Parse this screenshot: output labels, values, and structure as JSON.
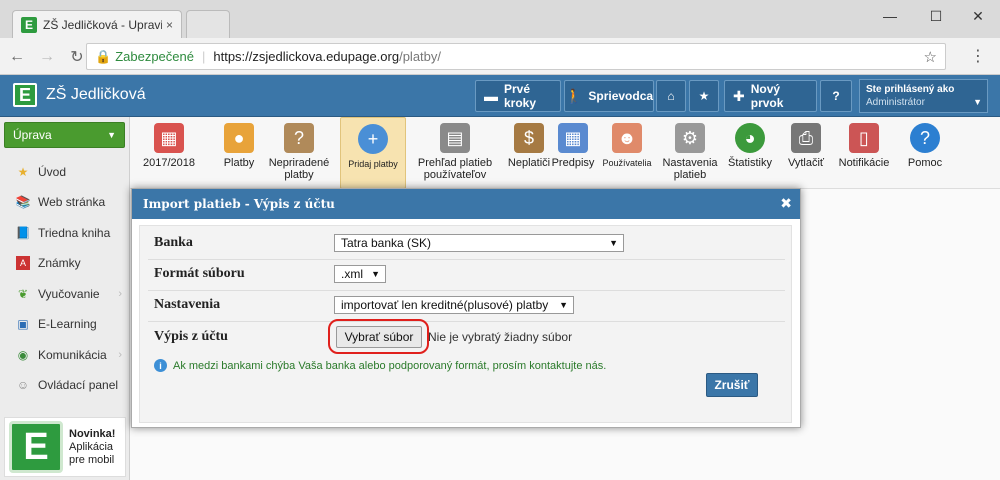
{
  "browser": {
    "tab_title": "ZŠ Jedličková - Upraviť v:",
    "tab_close": "×",
    "omni_secure": "Zabezpečené",
    "omni_host": "https://zsjedlickova.edupage.org",
    "omni_path": "/platby/"
  },
  "header": {
    "school": "ZŠ Jedličková",
    "prve_kroky": "Prvé kroky",
    "sprievodca": "Sprievodca",
    "novy_prvok": "Nový prvok",
    "help": "?",
    "user_label": "Ste prihlásený ako",
    "user_role": "Administrátor"
  },
  "sidebar": {
    "uprava": "Úprava",
    "items": [
      {
        "label": "Úvod",
        "icon": "star-icon",
        "chev": false
      },
      {
        "label": "Web stránka",
        "icon": "books-icon",
        "chev": false
      },
      {
        "label": "Triedna kniha",
        "icon": "book-icon",
        "chev": false
      },
      {
        "label": "Známky",
        "icon": "grades-icon",
        "chev": false
      },
      {
        "label": "Vyučovanie",
        "icon": "leaf-icon",
        "chev": true
      },
      {
        "label": "E-Learning",
        "icon": "monitor-icon",
        "chev": false
      },
      {
        "label": "Komunikácia",
        "icon": "globe-icon",
        "chev": true
      },
      {
        "label": "Ovládací panel",
        "icon": "panel-icon",
        "chev": false
      }
    ],
    "novinka_title": "Novinka!",
    "novinka_line1": "Aplikácia",
    "novinka_line2": "pre mobil"
  },
  "toolbar": [
    {
      "label": "2017/2018",
      "icon": "calendar-icon",
      "color": "#d9534f"
    },
    {
      "label": "Platby",
      "icon": "coins-icon",
      "color": "#e8a33a"
    },
    {
      "label": "Nepriradené platby",
      "icon": "unassigned-icon",
      "color": "#b08a5a"
    },
    {
      "label": "Pridaj platby",
      "icon": "add-payment-icon",
      "color": "#4a8fd6",
      "active": true
    },
    {
      "label": "Prehľad platieb používateľov",
      "icon": "overview-icon",
      "color": "#8a8a8a"
    },
    {
      "label": "Neplatiči",
      "icon": "money-bag-icon",
      "color": "#a67a43"
    },
    {
      "label": "Predpisy",
      "icon": "calendar2-icon",
      "color": "#5a8ad0"
    },
    {
      "label": "Používatelia",
      "icon": "users-icon",
      "color": "#e08a6a"
    },
    {
      "label": "Nastavenia platieb",
      "icon": "gear-icon",
      "color": "#999999"
    },
    {
      "label": "Štatistiky",
      "icon": "pie-chart-icon",
      "color": "#3c9a3c"
    },
    {
      "label": "Vytlačiť",
      "icon": "printer-icon",
      "color": "#777777"
    },
    {
      "label": "Notifikácie",
      "icon": "phone-icon",
      "color": "#cc5555"
    },
    {
      "label": "Pomoc",
      "icon": "help-icon",
      "color": "#2c7fd1"
    }
  ],
  "dialog": {
    "title": "Import platieb - Výpis z účtu",
    "banka_label": "Banka",
    "banka_value": "Tatra banka (SK)",
    "format_label": "Formát súboru",
    "format_value": ".xml",
    "nastavenia_label": "Nastavenia",
    "nastavenia_value": "importovať len kreditné(plusové) platby",
    "vypis_label": "Výpis z účtu",
    "file_button": "Vybrať súbor",
    "no_file": "Nie je vybratý žiadny súbor",
    "info": "Ak medzi bankami chýba Vaša banka alebo podporovaný formát, prosím kontaktujte nás.",
    "cancel": "Zrušiť"
  },
  "colors": {
    "accent": "#3b76a8",
    "green": "#4a9b2f",
    "highlight": "#e0201c"
  }
}
